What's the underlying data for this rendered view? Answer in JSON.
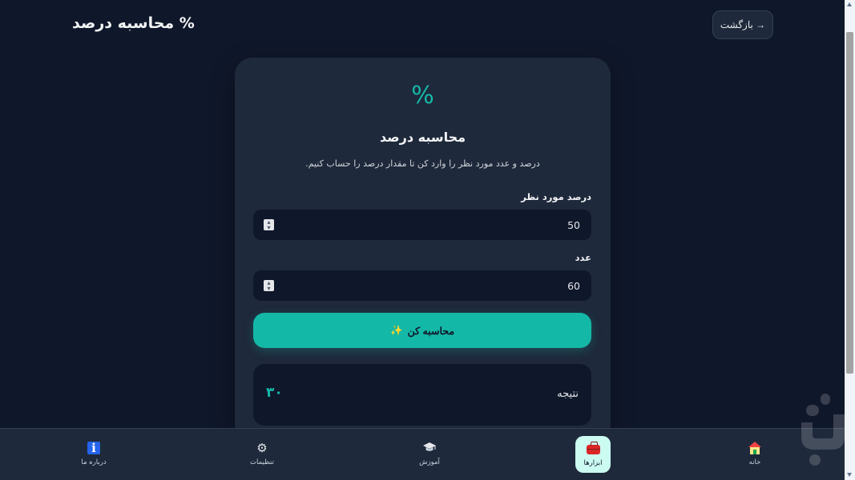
{
  "header": {
    "title": "% محاسبه درصد",
    "back_label": "→ بازگشت"
  },
  "card": {
    "icon": "%",
    "title": "محاسبه درصد",
    "subtitle": "درصد و عدد مورد نظر را وارد کن تا مقدار درصد را حساب کنیم.",
    "percent_field": {
      "label": "درصد مورد نظر",
      "value": "50"
    },
    "number_field": {
      "label": "عدد",
      "value": "60"
    },
    "calculate_label": "محاسبه کن",
    "calculate_icon": "✨",
    "result": {
      "label": "نتیجه",
      "value": "۳۰"
    }
  },
  "bottom_nav": {
    "items": [
      {
        "label": "درباره ما",
        "icon": "info-icon"
      },
      {
        "label": "تنظیمات",
        "icon": "gear-icon"
      },
      {
        "label": "آموزش",
        "icon": "graduation-cap-icon"
      },
      {
        "label": "ابزارها",
        "icon": "toolbox-icon",
        "active": true
      },
      {
        "label": "خانه",
        "icon": "home-icon"
      }
    ]
  },
  "colors": {
    "background": "#0f172a",
    "card": "#1e293b",
    "accent": "#14b8a6",
    "active_nav": "#ccfbf1"
  }
}
